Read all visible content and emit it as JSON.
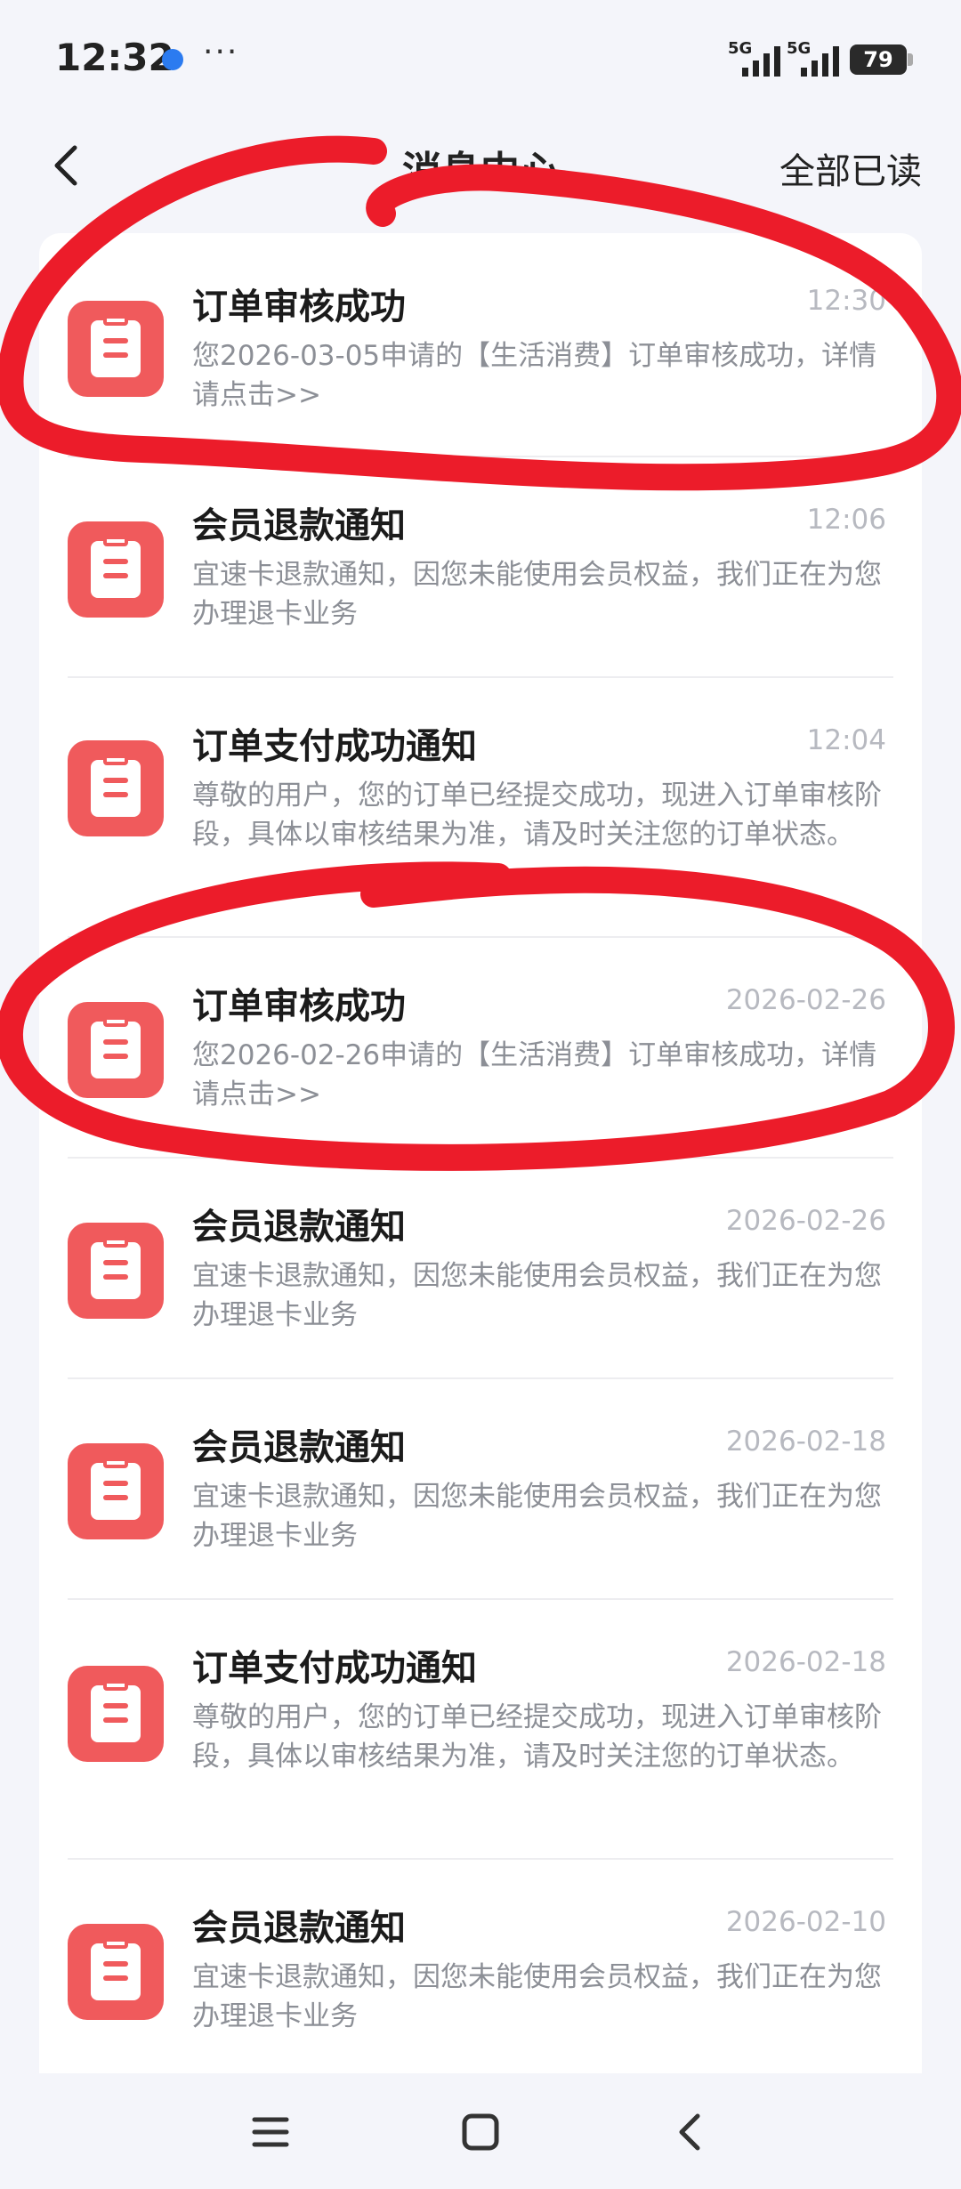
{
  "status_bar": {
    "time": "12:32",
    "more": "···",
    "signal_1": "5G",
    "signal_2": "5G",
    "battery": "79"
  },
  "header": {
    "title": "消息中心",
    "read_all": "全部已读"
  },
  "messages": [
    {
      "title": "订单审核成功",
      "time": "12:30",
      "body": "您2026-03-05申请的【生活消费】订单审核成功，详情请点击>>"
    },
    {
      "title": "会员退款通知",
      "time": "12:06",
      "body": "宜速卡退款通知，因您未能使用会员权益，我们正在为您办理退卡业务"
    },
    {
      "title": "订单支付成功通知",
      "time": "12:04",
      "body": "尊敬的用户，您的订单已经提交成功，现进入订单审核阶段，具体以审核结果为准，请及时关注您的订单状态。"
    },
    {
      "title": "订单审核成功",
      "time": "2026-02-26",
      "body": "您2026-02-26申请的【生活消费】订单审核成功，详情请点击>>"
    },
    {
      "title": "会员退款通知",
      "time": "2026-02-26",
      "body": "宜速卡退款通知，因您未能使用会员权益，我们正在为您办理退卡业务"
    },
    {
      "title": "会员退款通知",
      "time": "2026-02-18",
      "body": "宜速卡退款通知，因您未能使用会员权益，我们正在为您办理退卡业务"
    },
    {
      "title": "订单支付成功通知",
      "time": "2026-02-18",
      "body": "尊敬的用户，您的订单已经提交成功，现进入订单审核阶段，具体以审核结果为准，请及时关注您的订单状态。"
    },
    {
      "title": "会员退款通知",
      "time": "2026-02-10",
      "body": "宜速卡退款通知，因您未能使用会员权益，我们正在为您办理退卡业务"
    }
  ],
  "colors": {
    "accent": "#f05a5c",
    "marker": "#ec1c2a",
    "background": "#f4f5fa"
  },
  "icons": {
    "message_icon": "clipboard-icon",
    "back": "chevron-left-icon",
    "nav": [
      "menu-icon",
      "home-square-icon",
      "back-triangle-icon"
    ]
  }
}
